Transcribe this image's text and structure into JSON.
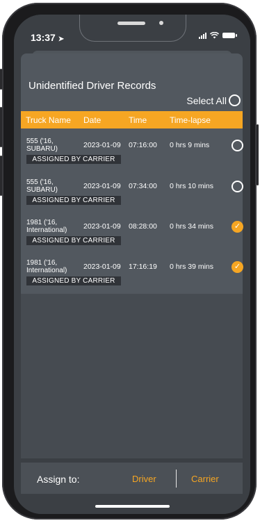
{
  "status_bar": {
    "time": "13:37",
    "location_glyph": "➤"
  },
  "page": {
    "title": "Unidentified Driver Records",
    "select_all_label": "Select All"
  },
  "table": {
    "headers": [
      "Truck Name",
      "Date",
      "Time",
      "Time-lapse"
    ],
    "rows": [
      {
        "truck": "555 ('16, SUBARU)",
        "date": "2023-01-09",
        "time": "07:16:00",
        "lapse": "0 hrs 9 mins",
        "tag": "ASSIGNED BY CARRIER",
        "checked": false
      },
      {
        "truck": "555 ('16, SUBARU)",
        "date": "2023-01-09",
        "time": "07:34:00",
        "lapse": "0 hrs 10 mins",
        "tag": "ASSIGNED BY CARRIER",
        "checked": false
      },
      {
        "truck": "1981 ('16, International)",
        "date": "2023-01-09",
        "time": "08:28:00",
        "lapse": "0 hrs 34 mins",
        "tag": "ASSIGNED BY CARRIER",
        "checked": true
      },
      {
        "truck": "1981 ('16, International)",
        "date": "2023-01-09",
        "time": "17:16:19",
        "lapse": "0 hrs 39 mins",
        "tag": "ASSIGNED BY CARRIER",
        "checked": true
      }
    ]
  },
  "footer": {
    "assign_label": "Assign to:",
    "driver_label": "Driver",
    "carrier_label": "Carrier"
  },
  "colors": {
    "accent": "#f6a623",
    "panel": "#52585f",
    "tag_bg": "#303338"
  },
  "icons": {
    "check": "✓"
  }
}
